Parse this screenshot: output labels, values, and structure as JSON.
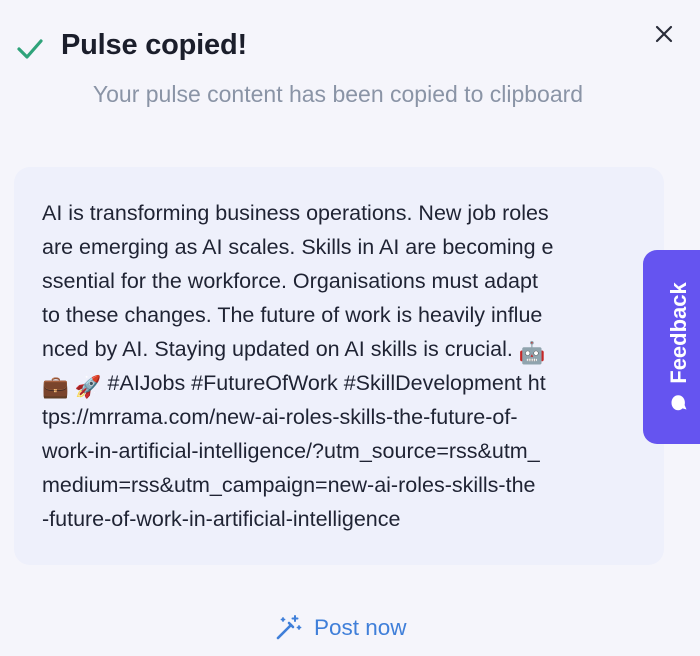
{
  "toast": {
    "title": "Pulse copied!",
    "subtitle": "Your pulse content has been copied to clipboard"
  },
  "content": {
    "lines": [
      "AI is transforming business operations. New job roles",
      "are emerging as AI scales. Skills in AI are becoming e",
      "ssential for the workforce. Organisations must adapt",
      "to these changes. The future of work is heavily influe",
      "nced by AI. Staying updated on AI skills is crucial.",
      " #AIJobs #FutureOfWork #SkillDevelopment ht",
      "tps://mrrama.com/new-ai-roles-skills-the-future-of-",
      "work-in-artificial-intelligence/?utm_source=rss&utm_",
      "medium=rss&utm_campaign=new-ai-roles-skills-the",
      "-future-of-work-in-artificial-intelligence"
    ],
    "emojis": {
      "robot": "🤖",
      "briefcase": "💼",
      "rocket": "🚀"
    }
  },
  "feedback": {
    "label": "Feedback"
  },
  "actions": {
    "post_now": "Post now"
  },
  "colors": {
    "success": "#2fa37a",
    "accent": "#6554f0",
    "link": "#3f7fd9",
    "card": "#eef0fb"
  },
  "icons": {
    "status": "check-icon",
    "close": "close-icon",
    "feedback": "chat-bubble-icon",
    "post": "magic-wand-icon"
  }
}
